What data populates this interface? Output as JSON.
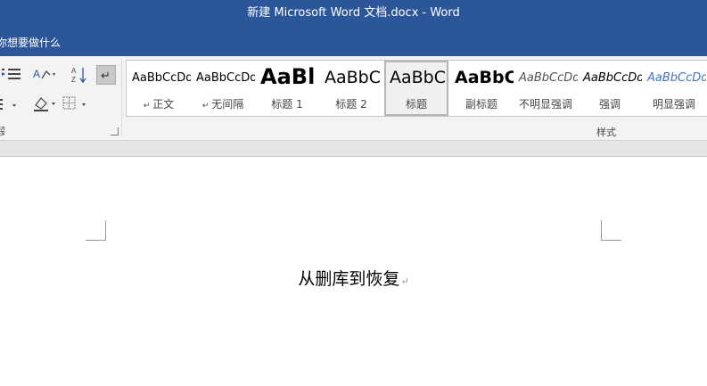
{
  "window": {
    "title": "新建 Microsoft Word 文档.docx  -  Word"
  },
  "tell_me": {
    "placeholder": "你想要做什么"
  },
  "ribbon": {
    "paragraph_group": {
      "label": "段落",
      "icons": [
        "increase-indent-icon",
        "text-direction-icon",
        "sort-icon",
        "show-formatting-marks-icon",
        "line-spacing-icon",
        "shading-icon",
        "borders-icon"
      ]
    },
    "styles_group": {
      "label": "样式",
      "items": [
        {
          "sample": "AaBbCcDd",
          "name": "正文",
          "mark": "↵",
          "font_px": 13
        },
        {
          "sample": "AaBbCcDd",
          "name": "无间隔",
          "mark": "↵",
          "font_px": 13
        },
        {
          "sample": "AaBl",
          "name": "标题 1",
          "mark": "",
          "font_px": 24,
          "bold": true
        },
        {
          "sample": "AaBbC",
          "name": "标题 2",
          "mark": "",
          "font_px": 19
        },
        {
          "sample": "AaBbC",
          "name": "标题",
          "mark": "",
          "font_px": 19,
          "selected": true
        },
        {
          "sample": "AaBbC",
          "name": "副标题",
          "mark": "",
          "font_px": 19,
          "bold": true
        },
        {
          "sample": "AaBbCcDd",
          "name": "不明显强调",
          "mark": "",
          "font_px": 13,
          "italic": true,
          "color": "#555555"
        },
        {
          "sample": "AaBbCcDd",
          "name": "强调",
          "mark": "",
          "font_px": 13,
          "italic": true
        },
        {
          "sample": "AaBbCcDd",
          "name": "明显强调",
          "mark": "",
          "font_px": 13,
          "italic": true,
          "color": "#4472c4"
        }
      ]
    }
  },
  "document": {
    "heading": "从删库到恢复",
    "paragraph_mark": "↵"
  },
  "colors": {
    "title_bar": "#2b579a",
    "ribbon": "#f3f3f3",
    "accent": "#4472c4"
  }
}
